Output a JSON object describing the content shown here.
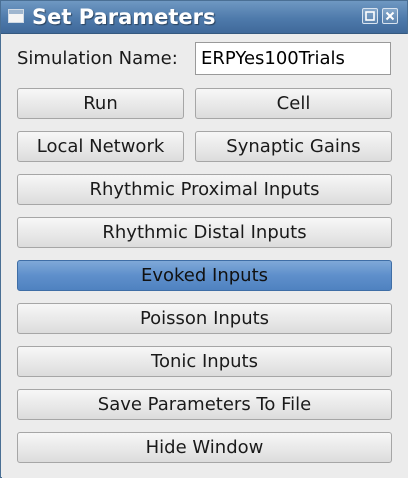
{
  "window": {
    "title": "Set Parameters",
    "icon": "app-window-icon",
    "controls": [
      "maximize-icon",
      "close-icon"
    ]
  },
  "form": {
    "simulation_name_label": "Simulation Name:",
    "simulation_name_value": "ERPYes100Trials"
  },
  "buttons": {
    "run": "Run",
    "cell": "Cell",
    "local_network": "Local Network",
    "synaptic_gains": "Synaptic Gains",
    "rhythmic_proximal": "Rhythmic Proximal Inputs",
    "rhythmic_distal": "Rhythmic Distal Inputs",
    "evoked": "Evoked Inputs",
    "poisson": "Poisson Inputs",
    "tonic": "Tonic Inputs",
    "save": "Save Parameters To File",
    "hide": "Hide Window"
  },
  "colors": {
    "titlebar": "#4e7aab",
    "active_button": "#5e8fcb",
    "background": "#ececec"
  },
  "state": {
    "highlighted_button": "Evoked Inputs"
  }
}
